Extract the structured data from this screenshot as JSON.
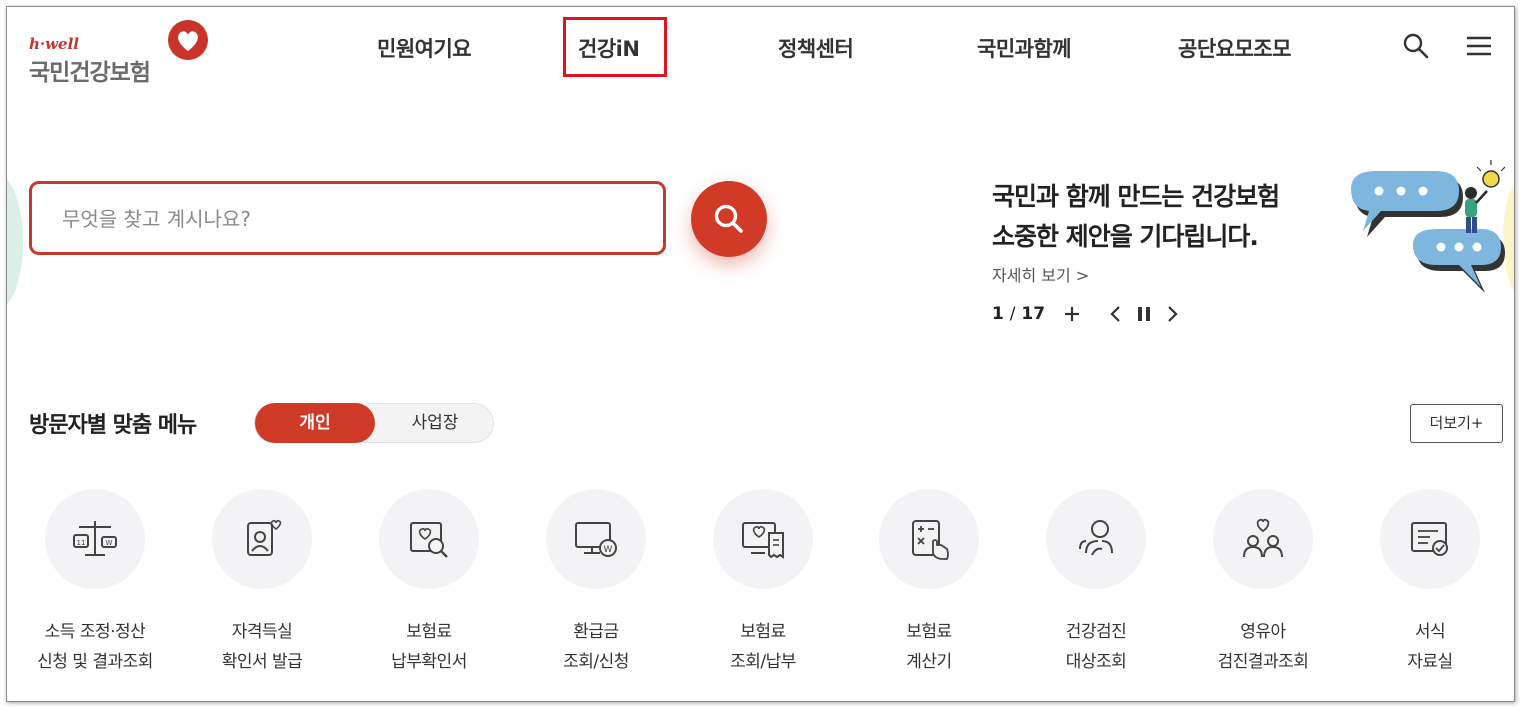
{
  "header": {
    "logo_small": "h·well",
    "logo_main": "국민건강보험",
    "nav": [
      "민원여기요",
      "건강iN",
      "정책센터",
      "국민과함께",
      "공단요모조모"
    ]
  },
  "search": {
    "placeholder": "무엇을 찾고 계시나요?",
    "value": ""
  },
  "banner": {
    "title_line1": "국민과 함께 만드는 건강보험",
    "title_line2": "소중한 제안을 기다립니다.",
    "link": "자세히 보기 >",
    "page_current": "1",
    "page_sep": "/",
    "page_total": "17"
  },
  "section": {
    "title": "방문자별 맞춤 메뉴",
    "toggle_on": "개인",
    "toggle_off": "사업장",
    "more": "더보기+"
  },
  "menu": [
    {
      "label": "소득 조정·정산\n신청 및 결과조회",
      "icon": "scale-icon"
    },
    {
      "label": "자격득실\n확인서 발급",
      "icon": "person-card-icon"
    },
    {
      "label": "보험료\n납부확인서",
      "icon": "document-search-icon"
    },
    {
      "label": "환급금\n조회/신청",
      "icon": "monitor-won-icon"
    },
    {
      "label": "보험료\n조회/납부",
      "icon": "monitor-receipt-icon"
    },
    {
      "label": "보험료\n계산기",
      "icon": "calculator-icon"
    },
    {
      "label": "건강검진\n대상조회",
      "icon": "person-search-icon"
    },
    {
      "label": "영유아\n검진결과조회",
      "icon": "family-icon"
    },
    {
      "label": "서식\n자료실",
      "icon": "form-icon"
    }
  ],
  "colors": {
    "brand_red": "#d23a28",
    "highlight_box": "#e0141e",
    "icon_circle": "#f3f3f5"
  }
}
